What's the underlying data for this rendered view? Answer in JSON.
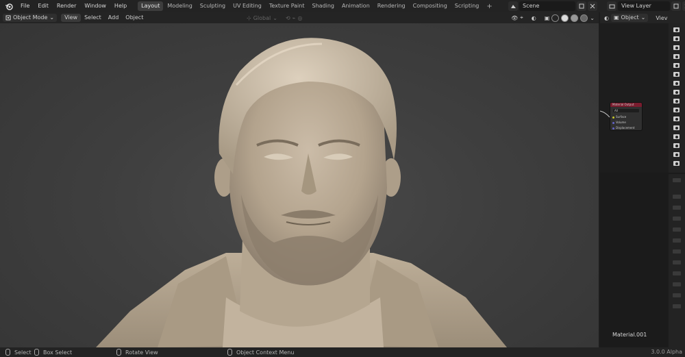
{
  "menubar": {
    "items": [
      "File",
      "Edit",
      "Render",
      "Window",
      "Help"
    ]
  },
  "workspaces": {
    "tabs": [
      "Layout",
      "Modeling",
      "Sculpting",
      "UV Editing",
      "Texture Paint",
      "Shading",
      "Animation",
      "Rendering",
      "Compositing",
      "Scripting"
    ],
    "active": "Layout",
    "add_label": "+"
  },
  "scene": {
    "name": "Scene"
  },
  "view_layer": {
    "name": "View Layer"
  },
  "viewport_header": {
    "mode": "Object Mode",
    "menus": [
      "View",
      "Select",
      "Add",
      "Object"
    ],
    "transform_orientation": "Global"
  },
  "properties_header": {
    "object_mode": "Object",
    "view_label": "Viev"
  },
  "node": {
    "title": "Material Output",
    "target": "All",
    "sockets": [
      "Surface",
      "Volume",
      "Displacement"
    ]
  },
  "material": {
    "name": "Material.001"
  },
  "statusbar": {
    "select": "Select",
    "box_select": "Box Select",
    "rotate_view": "Rotate View",
    "context_menu": "Object Context Menu",
    "version": "3.0.0 Alpha"
  },
  "colors": {
    "accent_tab": "#3d3d3d",
    "node_header": "#7a1c2e",
    "viewport_bg": "#3f3f3f",
    "sculpt_skin": "#bfb09c"
  }
}
